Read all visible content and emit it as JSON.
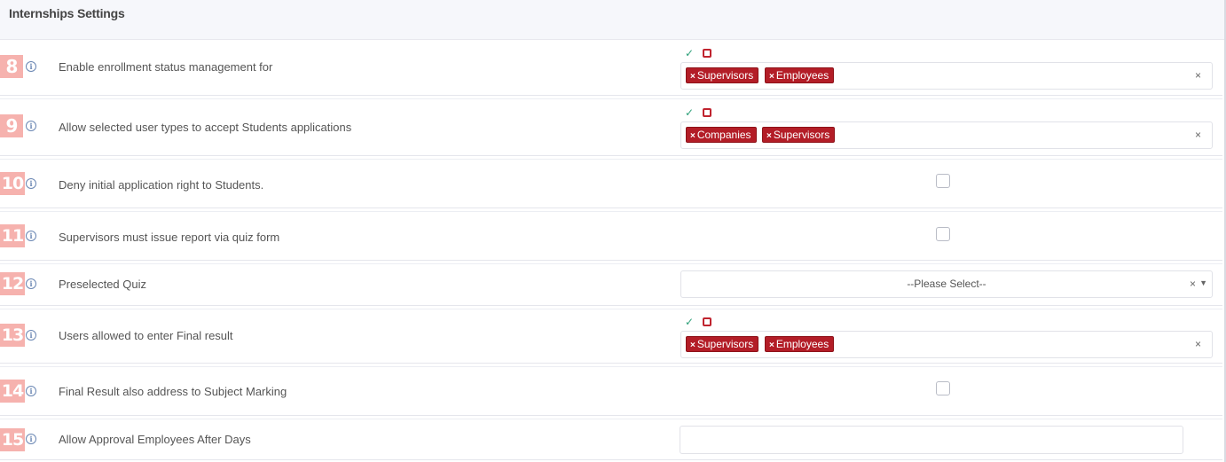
{
  "header": {
    "title": "Internships Settings"
  },
  "rows": [
    {
      "number": "8",
      "label": "Enable enrollment status management for",
      "tags": [
        "Supervisors",
        "Employees"
      ]
    },
    {
      "number": "9",
      "label": "Allow selected user types to accept Students applications",
      "tags": [
        "Companies",
        "Supervisors"
      ]
    },
    {
      "number": "10",
      "label": "Deny initial application right to Students."
    },
    {
      "number": "11",
      "label": "Supervisors must issue report via quiz form"
    },
    {
      "number": "12",
      "label": "Preselected Quiz",
      "select_value": "--Please Select--"
    },
    {
      "number": "13",
      "label": "Users allowed to enter Final result",
      "tags": [
        "Supervisors",
        "Employees"
      ]
    },
    {
      "number": "14",
      "label": "Final Result also address to Subject Marking"
    },
    {
      "number": "15",
      "label": "Allow Approval Employees After Days",
      "input_value": ""
    }
  ],
  "icons": {
    "info": "info-icon",
    "select_all": "check-square-icon",
    "deselect_all": "square-icon",
    "remove": "close-icon",
    "dropdown": "caret-down-icon"
  },
  "glyphs": {
    "info": "i",
    "check": "✓",
    "tag_x": "×",
    "clear": "×",
    "caret": "▼"
  },
  "colors": {
    "tag_bg": "#b31d27",
    "number_badge": "#f6b2ae",
    "check_green": "#2ea079",
    "header_bg": "#f6f7fb"
  }
}
